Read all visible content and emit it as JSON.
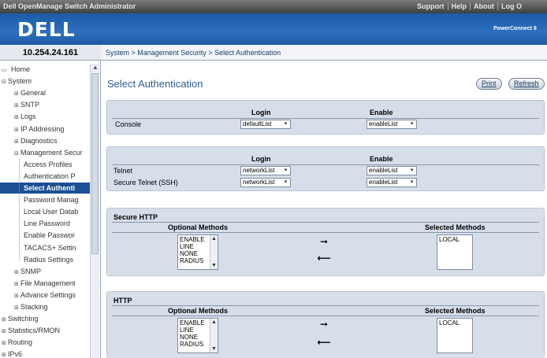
{
  "header": {
    "app_title": "Dell OpenManage Switch Administrator",
    "links": [
      "Support",
      "Help",
      "About",
      "Log O"
    ],
    "logo": "DELL",
    "product": "PowerConnect 6"
  },
  "nav": {
    "ip": "10.254.24.161",
    "tree": [
      {
        "label": "Home",
        "level": 0,
        "exp": "",
        "selected": false
      },
      {
        "label": "System",
        "level": 0,
        "exp": "⊟",
        "selected": false
      },
      {
        "label": "General",
        "level": 1,
        "exp": "⊞",
        "selected": false
      },
      {
        "label": "SNTP",
        "level": 1,
        "exp": "⊞",
        "selected": false
      },
      {
        "label": "Logs",
        "level": 1,
        "exp": "⊞",
        "selected": false
      },
      {
        "label": "IP Addressing",
        "level": 1,
        "exp": "⊞",
        "selected": false
      },
      {
        "label": "Diagnostics",
        "level": 1,
        "exp": "⊞",
        "selected": false
      },
      {
        "label": "Management Secur",
        "level": 1,
        "exp": "⊟",
        "selected": false
      },
      {
        "label": "Access Profiles",
        "level": 2,
        "exp": "",
        "selected": false
      },
      {
        "label": "Authentication P",
        "level": 2,
        "exp": "",
        "selected": false
      },
      {
        "label": "Select Authenti",
        "level": 2,
        "exp": "",
        "selected": true
      },
      {
        "label": "Password Manag",
        "level": 2,
        "exp": "",
        "selected": false
      },
      {
        "label": "Local User Datab",
        "level": 2,
        "exp": "",
        "selected": false
      },
      {
        "label": "Line Password",
        "level": 2,
        "exp": "",
        "selected": false
      },
      {
        "label": "Enable Passwor",
        "level": 2,
        "exp": "",
        "selected": false
      },
      {
        "label": "TACACS+ Settin",
        "level": 2,
        "exp": "",
        "selected": false
      },
      {
        "label": "Radius Settings",
        "level": 2,
        "exp": "",
        "selected": false
      },
      {
        "label": "SNMP",
        "level": 1,
        "exp": "⊞",
        "selected": false
      },
      {
        "label": "File Management",
        "level": 1,
        "exp": "⊞",
        "selected": false
      },
      {
        "label": "Advance Settings",
        "level": 1,
        "exp": "⊞",
        "selected": false
      },
      {
        "label": "Stacking",
        "level": 1,
        "exp": "⊞",
        "selected": false
      },
      {
        "label": "Switching",
        "level": 0,
        "exp": "⊞",
        "selected": false
      },
      {
        "label": "Statistics/RMON",
        "level": 0,
        "exp": "⊞",
        "selected": false
      },
      {
        "label": "Routing",
        "level": 0,
        "exp": "⊞",
        "selected": false
      },
      {
        "label": "IPv6",
        "level": 0,
        "exp": "⊞",
        "selected": false
      }
    ]
  },
  "breadcrumb": "System > Management Security > Select Authentication",
  "page": {
    "title": "Select Authentication",
    "print_label": "Print",
    "refresh_label": "Refresh"
  },
  "console_panel": {
    "col_login": "Login",
    "col_enable": "Enable",
    "rows": [
      {
        "name": "Console",
        "login": "defaultList",
        "enable": "enableList"
      }
    ]
  },
  "remote_panel": {
    "col_login": "Login",
    "col_enable": "Enable",
    "rows": [
      {
        "name": "Telnet",
        "login": "networkList",
        "enable": "enableList"
      },
      {
        "name": "Secure Telnet (SSH)",
        "login": "networkList",
        "enable": "enableList"
      }
    ]
  },
  "secure_http": {
    "title": "Secure HTTP",
    "optional_header": "Optional Methods",
    "selected_header": "Selected Methods",
    "optional": [
      "ENABLE",
      "LINE",
      "NONE",
      "RADIUS"
    ],
    "selected": [
      "LOCAL"
    ]
  },
  "http": {
    "title": "HTTP",
    "optional_header": "Optional Methods",
    "selected_header": "Selected Methods",
    "optional": [
      "ENABLE",
      "LINE",
      "NONE",
      "RADIUS"
    ],
    "selected": [
      "LOCAL"
    ]
  },
  "icons": {
    "dropdown": "chevron-down-icon",
    "move_right": "arrow-right-icon",
    "move_left": "arrow-left-icon"
  },
  "colors": {
    "brand_blue": "#1a5ca6",
    "panel_bg": "#d6deea",
    "selected_nav": "#1c4f94",
    "title_blue": "#2d5c9a"
  }
}
